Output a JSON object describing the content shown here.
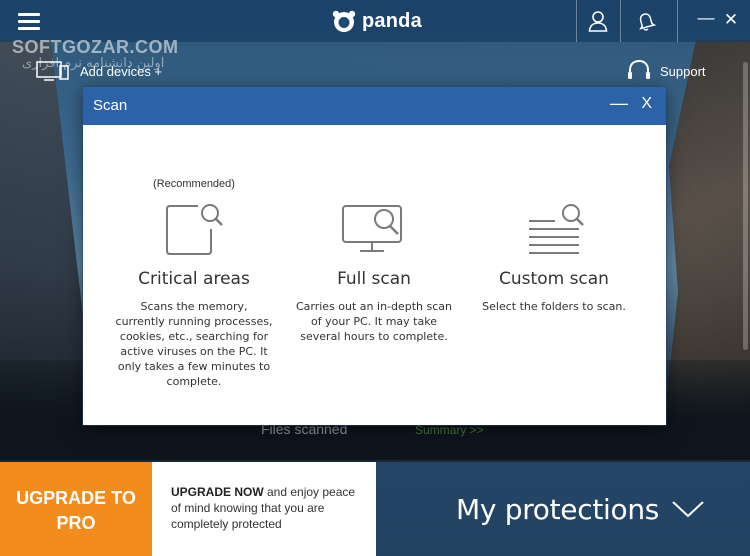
{
  "app": {
    "logo_text": "panda",
    "watermark": "SOFTGOZAR.COM",
    "watermark_sub": "اولین دانشنامه نرم افزاری"
  },
  "header": {
    "add_devices_label": "Add devices +",
    "support_label": "Support",
    "icons": [
      "menu-icon",
      "user-icon",
      "bell-icon",
      "minimize-icon",
      "close-icon"
    ]
  },
  "background_status": {
    "files_scanned_label": "Files scanned",
    "summary_link": "Summary >>"
  },
  "dialog": {
    "title": "Scan",
    "minimize_glyph": "—",
    "close_glyph": "X",
    "recommended_label": "(Recommended)",
    "options": [
      {
        "title": "Critical areas",
        "description": "Scans the memory, currently running processes, cookies, etc., searching for active viruses on the PC. It only takes a few minutes to complete.",
        "icon": "critical-areas-icon"
      },
      {
        "title": "Full scan",
        "description": "Carries out an in-depth scan of your PC. It may take several hours to complete.",
        "icon": "full-scan-icon"
      },
      {
        "title": "Custom scan",
        "description": "Select the folders to scan.",
        "icon": "custom-scan-icon"
      }
    ]
  },
  "footer": {
    "upgrade_button_line1": "UGPRADE TO",
    "upgrade_button_line2": "PRO",
    "upgrade_bold": "UPGRADE NOW",
    "upgrade_text": " and enjoy peace of mind knowing that you are completely protected",
    "protections_label": "My protections"
  },
  "colors": {
    "accent_orange": "#f38c1c",
    "dialog_title_blue": "#2c63a8",
    "icon_gray": "#7a7a7a"
  }
}
